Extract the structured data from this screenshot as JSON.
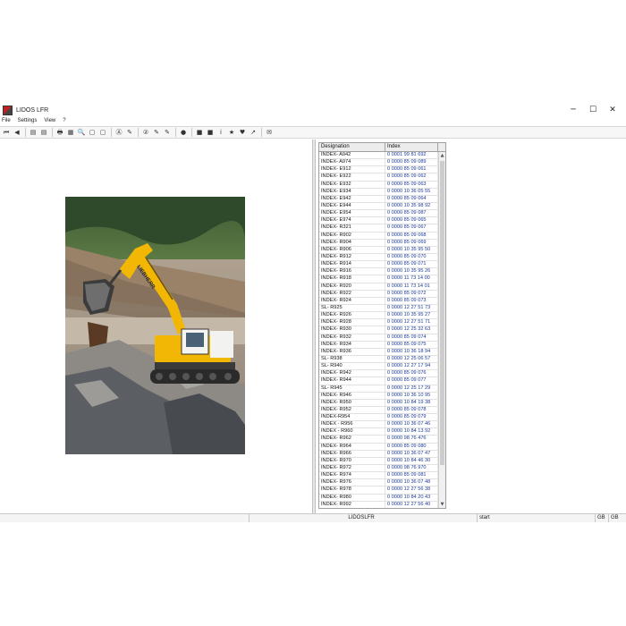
{
  "window": {
    "title": "LIDOS LFR",
    "controls": {
      "minimize": "─",
      "maximize": "☐",
      "close": "✕"
    }
  },
  "menu": {
    "items": [
      "File",
      "Settings",
      "View",
      "?"
    ]
  },
  "toolbar": {
    "groups": [
      [
        "⏮",
        "◀"
      ],
      [
        "▤",
        "▤"
      ],
      [
        "🖶",
        "▦",
        "🔍",
        "▢",
        "▢"
      ],
      [
        "Ⓐ",
        "✎"
      ],
      [
        "②",
        "✎",
        "✎"
      ],
      [
        "●"
      ],
      [
        "■",
        "■",
        "i",
        "★",
        "♥",
        "↗"
      ],
      [
        "✉"
      ]
    ]
  },
  "table": {
    "headers": {
      "designation": "Designation",
      "index": "Index"
    },
    "rows": [
      [
        "INDEX- A942",
        "0 0001 99 81 692"
      ],
      [
        "INDEX- A974",
        "0 0000 85 09 089"
      ],
      [
        "INDEX- E912",
        "0 0000 85 09 061"
      ],
      [
        "INDEX- E922",
        "0 0000 85 09 062"
      ],
      [
        "INDEX- E932",
        "0 0000 85 09 063"
      ],
      [
        "INDEX- E934",
        "0 0000 10 36 05 55"
      ],
      [
        "INDEX- E942",
        "0 0000 85 09 064"
      ],
      [
        "INDEX- E944",
        "0 0000 10 35 98 92"
      ],
      [
        "INDEX- E954",
        "0 0000 85 09 087"
      ],
      [
        "INDEX- E974",
        "0 0000 85 09 065"
      ],
      [
        "INDEX- R321",
        "0 0000 85 09 067"
      ],
      [
        "INDEX- R902",
        "0 0000 85 09 068"
      ],
      [
        "INDEX- R904",
        "0 0000 85 09 069"
      ],
      [
        "INDEX- R906",
        "0 0000 10 35 95 50"
      ],
      [
        "INDEX- R912",
        "0 0000 85 09 070"
      ],
      [
        "INDEX- R914",
        "0 0000 85 09 071"
      ],
      [
        "INDEX- R916",
        "0 0000 10 35 95 26"
      ],
      [
        "INDEX- R918",
        "0 0000 11 73 14 00"
      ],
      [
        "INDEX- R920",
        "0 0000 11 73 14 01"
      ],
      [
        "INDEX- R922",
        "0 0000 85 09 072"
      ],
      [
        "INDEX- R924",
        "0 0000 85 09 073"
      ],
      [
        "SL- R925",
        "0 0000 12 27 51 73"
      ],
      [
        "INDEX- R926",
        "0 0000 10 35 95 27"
      ],
      [
        "INDEX- R928",
        "0 0000 12 27 51 71"
      ],
      [
        "INDEX- R930",
        "0 0000 12 25 32 63"
      ],
      [
        "INDEX- R932",
        "0 0000 85 09 074"
      ],
      [
        "INDEX- R934",
        "0 0000 85 09 075"
      ],
      [
        "INDEX- R936",
        "0 0000 10 36 18 94"
      ],
      [
        "SL- R938",
        "0 0000 12 25 06 57"
      ],
      [
        "SL- R940",
        "0 0000 12 27 17 94"
      ],
      [
        "INDEX- R942",
        "0 0000 85 09 076"
      ],
      [
        "INDEX- R944",
        "0 0000 85 09 077"
      ],
      [
        "SL- R945",
        "0 0000 12 25 17 29"
      ],
      [
        "INDEX- R946",
        "0 0000 10 36 10 95"
      ],
      [
        "INDEX- R950",
        "0 0000 10 84 19 38"
      ],
      [
        "INDEX- R952",
        "0 0000 85 09 078"
      ],
      [
        "INDEX-R954",
        "0 0000 85 09 079"
      ],
      [
        "INDEX - R956",
        "0 0000 10 36 07 46"
      ],
      [
        "INDEX - R960",
        "0 0000 10 84 13 92"
      ],
      [
        "INDEX- R962",
        "0 0000 98 76 476"
      ],
      [
        "INDEX- R964",
        "0 0000 85 09 080"
      ],
      [
        "INDEX- R966",
        "0 0000 10 36 07 47"
      ],
      [
        "INDEX- R970",
        "0 0000 10 84 46 30"
      ],
      [
        "INDEX- R972",
        "0 0000 98 76 970"
      ],
      [
        "INDEX- R974",
        "0 0000 85 09 081"
      ],
      [
        "INDEX- R976",
        "0 0000 10 36 07 48"
      ],
      [
        "INDEX- R978",
        "0 0000 12 27 56 38"
      ],
      [
        "INDEX- R980",
        "0 0000 10 84 20 43"
      ],
      [
        "INDEX- R992",
        "0 0000 12 27 56 40"
      ]
    ]
  },
  "scrollbar": {
    "up": "▲",
    "down": "▼"
  },
  "statusbar": {
    "center": "LIDOSLFR",
    "state": "start",
    "mem1": "GB",
    "mem2": "GB"
  },
  "photo": {
    "brand_text": "LIEBHERR"
  },
  "colors": {
    "index_text": "#1a3a9a",
    "excavator_yellow": "#f2b705"
  }
}
